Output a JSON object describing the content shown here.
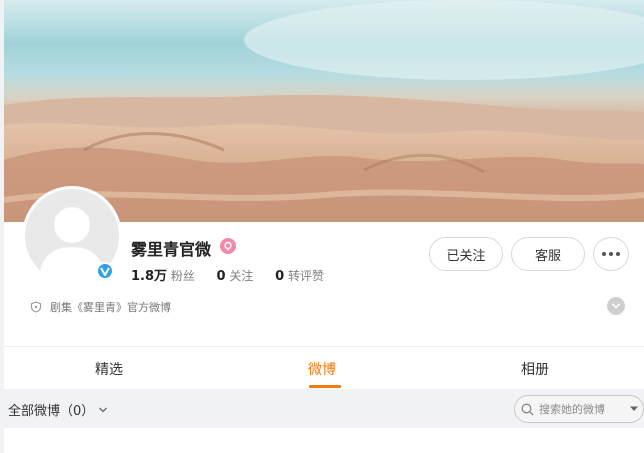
{
  "profile": {
    "name": "雾里青官微",
    "description": "剧集《雾里青》官方微博"
  },
  "stats": {
    "fans_count": "1.8万",
    "fans_label": "粉丝",
    "following_count": "0",
    "following_label": "关注",
    "engagement_count": "0",
    "engagement_label": "转评赞"
  },
  "actions": {
    "follow_label": "已关注",
    "service_label": "客服"
  },
  "tabs": [
    {
      "label": "精选"
    },
    {
      "label": "微博",
      "active": true
    },
    {
      "label": "相册"
    }
  ],
  "filter": {
    "label": "全部微博（0）"
  },
  "search": {
    "placeholder": "搜索她的微博"
  },
  "colors": {
    "accent": "#f47b10",
    "verified": "#2ea1e5",
    "vip": "#f58aa8"
  }
}
